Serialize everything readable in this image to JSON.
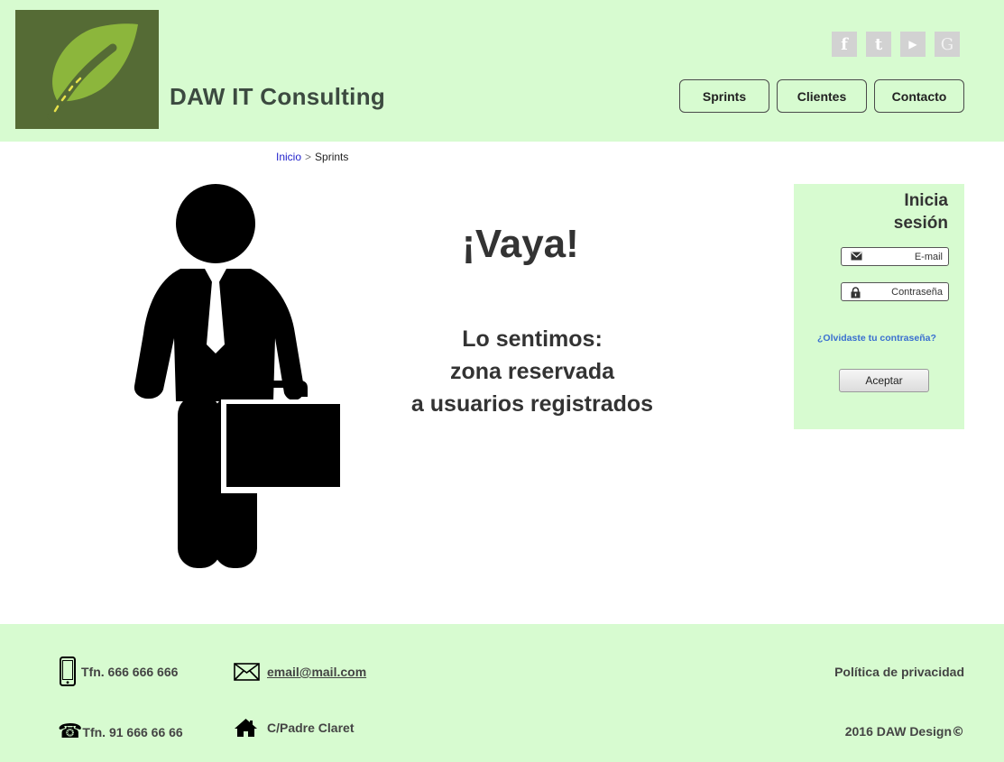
{
  "header": {
    "site_title": "DAW IT Consulting",
    "logo_icon": "leaf-road-logo",
    "social": [
      {
        "name": "facebook-icon",
        "glyph": "f"
      },
      {
        "name": "twitter-icon",
        "glyph": "t"
      },
      {
        "name": "youtube-icon",
        "glyph": "▶"
      },
      {
        "name": "google-icon",
        "glyph": "G"
      }
    ],
    "nav": [
      {
        "label": "Sprints"
      },
      {
        "label": "Clientes"
      },
      {
        "label": "Contacto"
      }
    ]
  },
  "breadcrumb": {
    "home": "Inicio",
    "separator": ">",
    "current": "Sprints"
  },
  "main": {
    "heading": "¡Vaya!",
    "message_line1": "Lo sentimos:",
    "message_line2": "zona reservada",
    "message_line3": "a usuarios registrados",
    "illustration_icon": "businessman-with-briefcase-icon"
  },
  "login": {
    "title_line1": "Inicia",
    "title_line2": "sesión",
    "email_placeholder": "E-mail",
    "password_placeholder": "Contraseña",
    "forgot_link": "¿Olvidaste tu contraseña?",
    "submit": "Aceptar"
  },
  "footer": {
    "mobile_phone": "Tfn. 666 666 666",
    "email": "email@mail.com",
    "privacy": "Política de privacidad",
    "landline": "Tfn. 91 666 66 66",
    "address": "C/Padre Claret",
    "copyright": "2016 DAW Design"
  },
  "colors": {
    "header_bg": "#d7fbd0",
    "logo_bg": "#556b35",
    "leaf_green": "#8cb63c",
    "link_blue": "#2222cc"
  }
}
